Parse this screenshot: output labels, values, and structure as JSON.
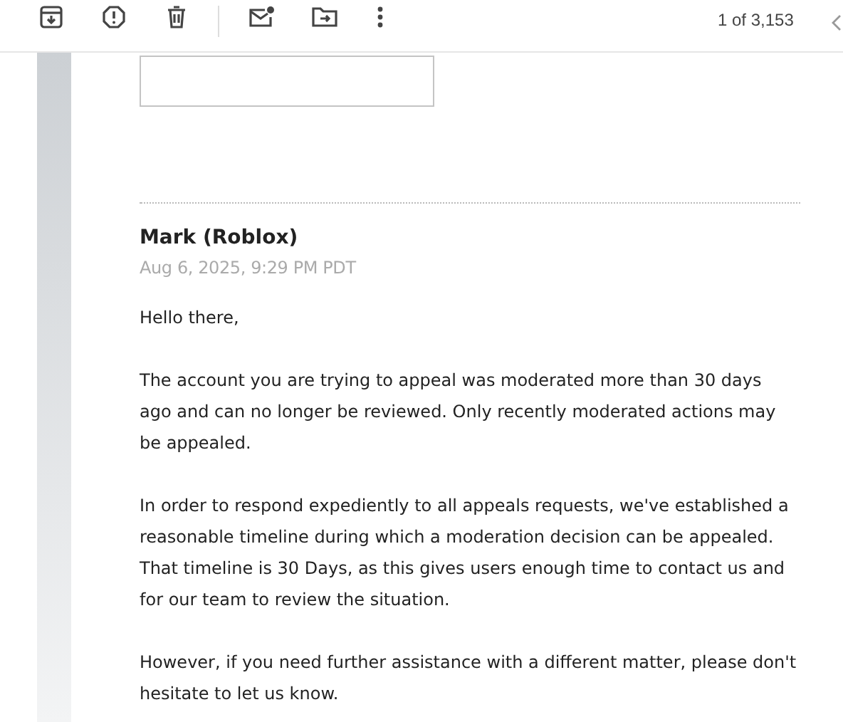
{
  "toolbar": {
    "counter": "1 of 3,153"
  },
  "message": {
    "sender": "Mark (Roblox)",
    "date": "Aug 6, 2025, 9:29 PM PDT",
    "paragraphs": [
      "Hello there,",
      "The account you are trying to appeal was moderated more than 30 days ago and can no longer be reviewed. Only recently moderated actions may be appealed.",
      "In order to respond expediently to all appeals requests, we've established a reasonable timeline during which a moderation decision can be appealed. That timeline is 30 Days, as this gives users enough time to contact us and for our team to review the situation.",
      "However, if you need further assistance with a different matter, please don't hesitate to let us know."
    ]
  }
}
